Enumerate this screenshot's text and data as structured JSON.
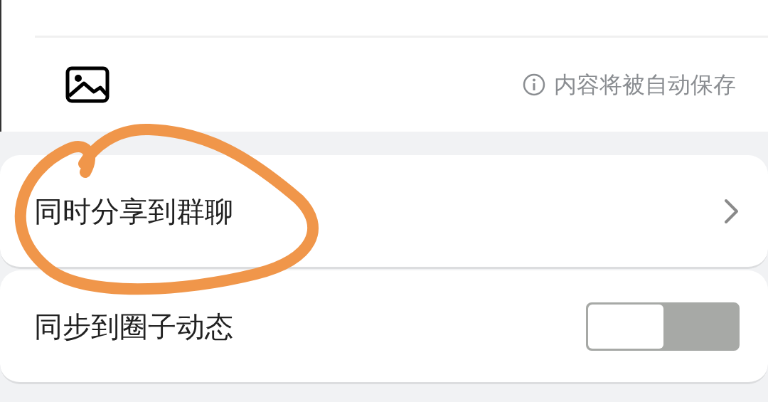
{
  "editor_footer": {
    "autosave_note": "内容将被自动保存"
  },
  "settings": [
    {
      "kind": "link",
      "label": "同时分享到群聊"
    },
    {
      "kind": "toggle",
      "label": "同步到圈子动态",
      "on": false
    }
  ]
}
